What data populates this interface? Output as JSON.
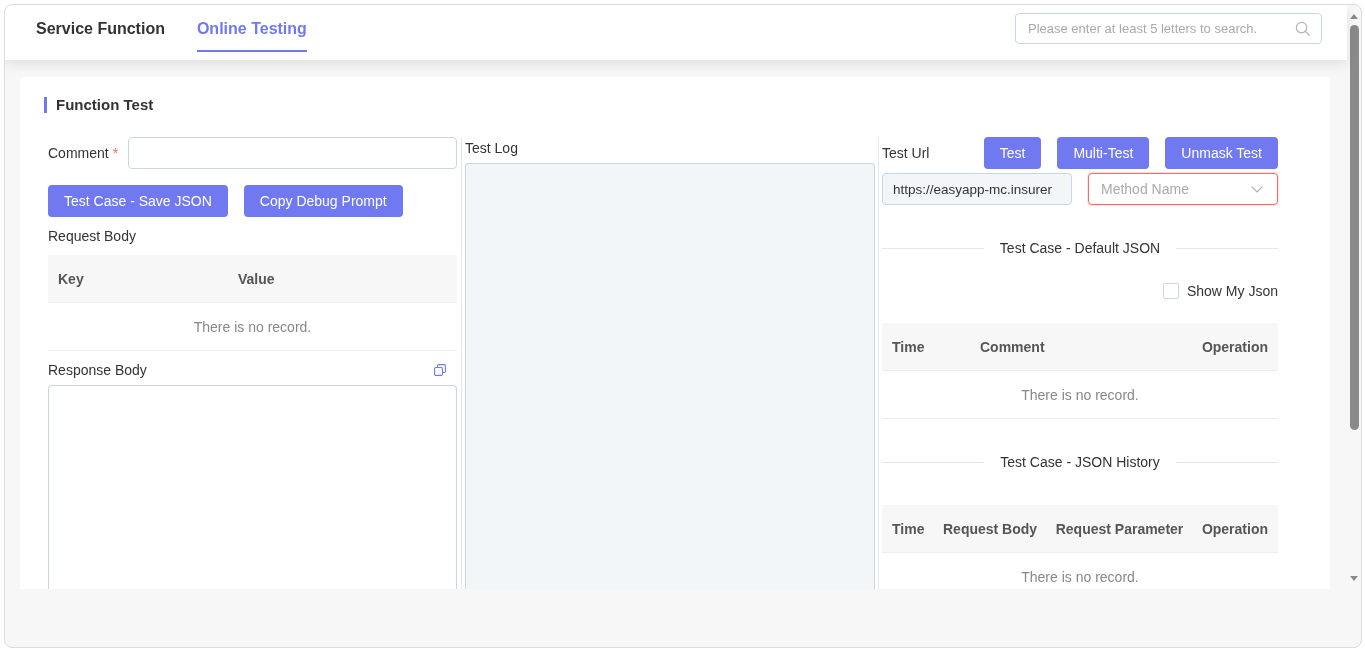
{
  "tabs": [
    {
      "label": "Service Function",
      "selected": false
    },
    {
      "label": "Online Testing",
      "selected": true
    }
  ],
  "search": {
    "placeholder": "Please enter at least 5 letters to search."
  },
  "section": {
    "title": "Function Test"
  },
  "comment": {
    "label": "Comment",
    "required_mark": "*"
  },
  "buttons": [
    "Test Case - Save JSON",
    "Copy Debug Prompt"
  ],
  "request_body": {
    "label": "Request Body",
    "columns": [
      "Key",
      "Value"
    ],
    "empty_text": "There is no record."
  },
  "response_body": {
    "label": "Response Body"
  },
  "test_log": {
    "label": "Test Log",
    "disabled": true
  },
  "test_url": {
    "label": "Test Url",
    "value": "https://easyapp-mc.insurer",
    "disabled": true
  },
  "actions": [
    "Test",
    "Multi-Test",
    "Unmask Test"
  ],
  "method": {
    "placeholder": "Method Name",
    "invalid": true
  },
  "default_json": {
    "title": "Test Case - Default JSON",
    "show_my_json": {
      "label": "Show My Json",
      "checked": false
    },
    "columns": [
      "Time",
      "Comment",
      "Operation"
    ],
    "empty_text": "There is no record."
  },
  "history": {
    "title": "Test Case - JSON History",
    "columns": [
      "Time",
      "Request Body",
      "Request Parameter",
      "Operation"
    ],
    "empty_text": "There is no record."
  }
}
